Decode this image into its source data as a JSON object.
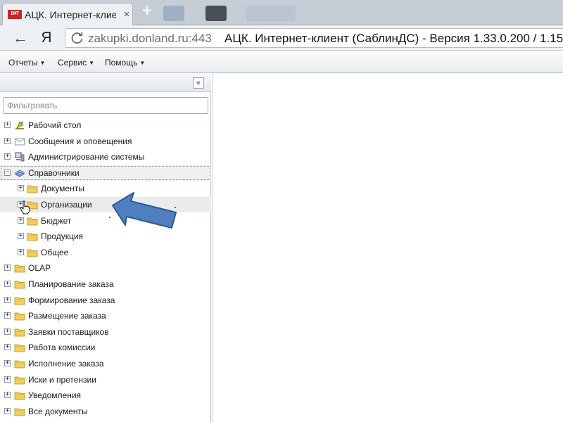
{
  "browser": {
    "tab_favicon_text": "БФТ",
    "tab_title": "АЦК. Интернет-клиен",
    "tab_close": "×",
    "new_tab": "+",
    "back": "←",
    "yandex": "Я",
    "url_host": "zakupki.donland.ru:443",
    "page_title": "АЦК. Интернет-клиент (СаблинДС) - Версия 1.33.0.200 / 1.15"
  },
  "menu": {
    "items": [
      {
        "label": "Отчеты"
      },
      {
        "label": "Сервис"
      },
      {
        "label": "Помощь"
      }
    ],
    "caret": "▼"
  },
  "sidebar": {
    "collapse": "«",
    "filter_placeholder": "Фильтровать",
    "tree": [
      {
        "label": "Рабочий стол",
        "icon": "desk-icon",
        "expander": "+"
      },
      {
        "label": "Сообщения и оповещения",
        "icon": "envelope-icon",
        "expander": "+"
      },
      {
        "label": "Администрирование системы",
        "icon": "computer-icon",
        "expander": "+"
      },
      {
        "label": "Справочники",
        "icon": "book-icon",
        "expander": "−"
      },
      {
        "label": "Документы",
        "icon": "folder-icon",
        "expander": "+"
      },
      {
        "label": "Организации",
        "icon": "folder-icon",
        "expander": "+"
      },
      {
        "label": "Бюджет",
        "icon": "folder-icon",
        "expander": "+"
      },
      {
        "label": "Продукция",
        "icon": "folder-icon",
        "expander": "+"
      },
      {
        "label": "Общее",
        "icon": "folder-icon",
        "expander": "+"
      },
      {
        "label": "OLAP",
        "icon": "folder-icon",
        "expander": "+"
      },
      {
        "label": "Планирование заказа",
        "icon": "folder-icon",
        "expander": "+"
      },
      {
        "label": "Формирование заказа",
        "icon": "folder-icon",
        "expander": "+"
      },
      {
        "label": "Размещение заказа",
        "icon": "folder-icon",
        "expander": "+"
      },
      {
        "label": "Заявки поставщиков",
        "icon": "folder-icon",
        "expander": "+"
      },
      {
        "label": "Работа комиссии",
        "icon": "folder-icon",
        "expander": "+"
      },
      {
        "label": "Исполнение заказа",
        "icon": "folder-icon",
        "expander": "+"
      },
      {
        "label": "Иски и претензии",
        "icon": "folder-icon",
        "expander": "+"
      },
      {
        "label": "Уведомления",
        "icon": "folder-icon",
        "expander": "+"
      },
      {
        "label": "Все документы",
        "icon": "folder-icon",
        "expander": "+"
      }
    ]
  },
  "colors": {
    "folder": "#f2cf5b",
    "arrow": "#4f7fc0",
    "favicon": "#c62828"
  }
}
